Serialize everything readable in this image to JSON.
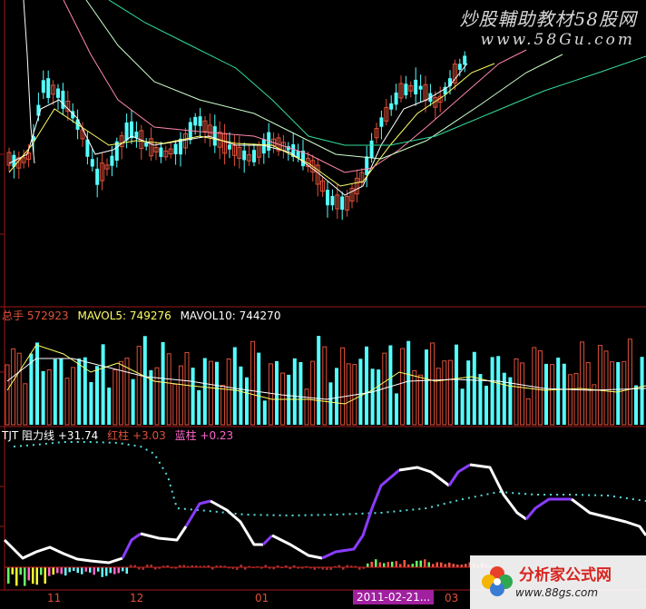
{
  "watermark": {
    "title": "炒股輔助教材58股网",
    "url": "www.58Gu.com"
  },
  "volume_panel": {
    "label": "总手",
    "value": "572923",
    "mavol5_label": "MAVOL5:",
    "mavol5_value": "749276",
    "mavol10_label": "MAVOL10:",
    "mavol10_value": "744270"
  },
  "indicator_panel": {
    "name": "TJT",
    "line_label": "阻力线",
    "line_value": "+31.74",
    "red_label": "红柱",
    "red_value": "+3.03",
    "blue_label": "蓝柱",
    "blue_value": "+0.23"
  },
  "time_axis": {
    "labels": [
      "11",
      "12",
      "01",
      "03"
    ],
    "highlight": "2011-02-21..."
  },
  "logo": {
    "name": "分析家公式网",
    "url": "www.88gs.com"
  },
  "colors": {
    "background": "#000000",
    "up_candle": "#e0503a",
    "down_candle": "#54ffff",
    "panel_border": "#a01818",
    "ma5": "#ffffff",
    "ma10": "#ffff66",
    "ma_long": "#33dd99",
    "resistance_white": "#ffffff",
    "resistance_purple": "#8a3cff",
    "dotted_line": "#55dddd"
  }
}
